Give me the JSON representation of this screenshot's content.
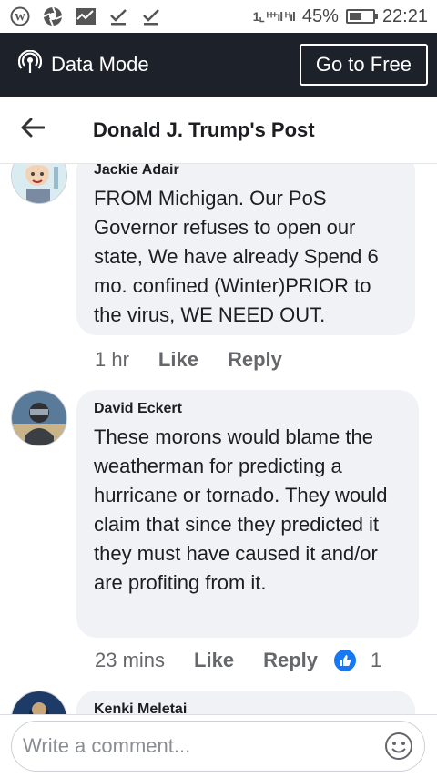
{
  "status": {
    "battery": "45%",
    "time": "22:21",
    "signal": "1⌞ ᴴ⁺ıl ᴴıl"
  },
  "databar": {
    "label": "Data Mode",
    "button": "Go to Free"
  },
  "header": {
    "title": "Donald J. Trump's Post"
  },
  "comments": [
    {
      "author": "Jackie Adair",
      "text": "FROM Michigan. Our PoS Governor refuses to open our state, We have already Spend 6 mo. confined (Winter)PRIOR to the virus, WE NEED OUT.",
      "time": "1 hr",
      "like": "Like",
      "reply": "Reply"
    },
    {
      "author": "David Eckert",
      "text": "These morons would blame the weatherman for predicting a hurricane or tornado. They would claim that since they predicted it they must have caused it and/or are profiting from it.",
      "time": "23 mins",
      "like": "Like",
      "reply": "Reply",
      "reactions": "1"
    },
    {
      "author": "Kenki Meletai"
    }
  ],
  "composer": {
    "placeholder": "Write a comment..."
  }
}
